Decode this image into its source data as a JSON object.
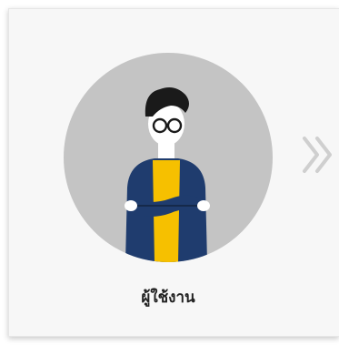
{
  "card": {
    "label": "ผู้ใช้งาน",
    "avatar_icon": "user-avatar-icon",
    "next_icon": "double-chevron-right-icon"
  },
  "colors": {
    "card_background": "#f7f7f7",
    "circle_background": "#c4c4c4",
    "hair": "#1a1a1a",
    "skin": "#ffffff",
    "jacket": "#1f3c6e",
    "shirt": "#f6c000",
    "chevron": "#cfcfcf"
  }
}
